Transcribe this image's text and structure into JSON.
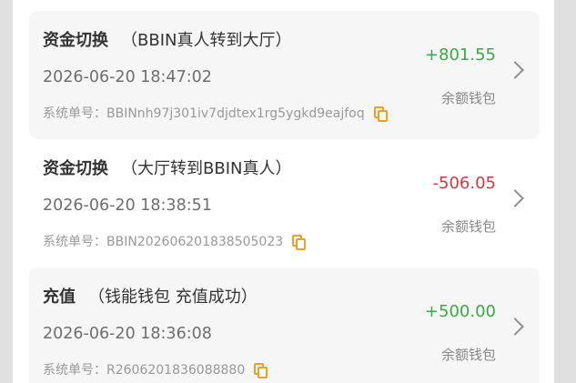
{
  "records": [
    {
      "title": "资金切换",
      "subtitle": "（BBIN真人转到大厅）",
      "time": "2026-06-20 18:47:02",
      "order_label": "系统单号：",
      "order_no": "BBINnh97j301iv7djdtex1rg5ygkd9eajfoq",
      "amount": "+801.55",
      "wallet": "余额钱包"
    },
    {
      "title": "资金切换",
      "subtitle": "（大厅转到BBIN真人）",
      "time": "2026-06-20 18:38:51",
      "order_label": "系统单号：",
      "order_no": "BBIN202606201838505023",
      "amount": "-506.05",
      "wallet": "余额钱包"
    },
    {
      "title": "充值",
      "subtitle": "（钱能钱包 充值成功）",
      "time": "2026-06-20 18:36:08",
      "order_label": "系统单号：",
      "order_no": "R2606201836088880",
      "amount": "+500.00",
      "wallet": "余额钱包"
    }
  ],
  "colors": {
    "positive": "#3aaa45",
    "negative": "#d9363e",
    "copy_icon": "#f0a020"
  },
  "icons": {
    "copy": "copy-icon",
    "chevron": "chevron-right-icon"
  }
}
